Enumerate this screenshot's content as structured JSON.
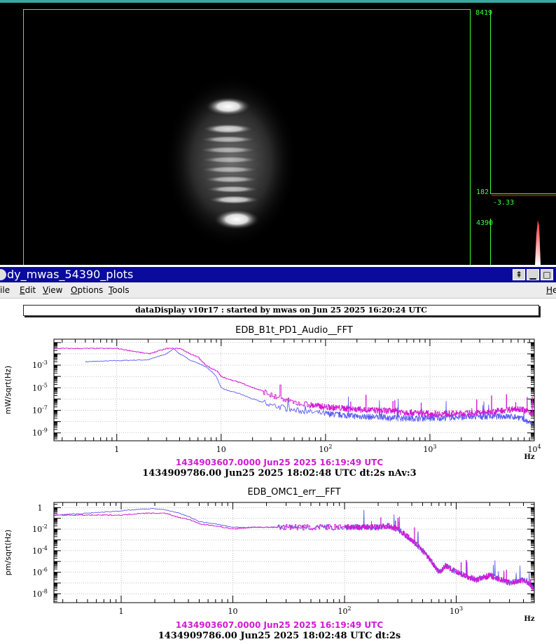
{
  "camera": {
    "readouts": {
      "max_top": "8419",
      "val_mid": "182",
      "val_neg": "-3.33",
      "val_lower": "4390"
    }
  },
  "window": {
    "title": "dy_mwas_54390_plots",
    "menus": [
      "File",
      "Edit",
      "View",
      "Options",
      "Tools"
    ],
    "menu_help": "He",
    "header": "dataDisplay v10r17 : started by mwas on Jun 25 2025 16:20:24 UTC"
  },
  "colors": {
    "reference": "#d21bd2",
    "current": "#5a5af0",
    "grid": "#9a9a9a"
  },
  "plots": [
    {
      "title": "EDB_B1t_PD1_Audio__FFT",
      "ylabel": "mW/sqrt(Hz)",
      "xunit": "Hz",
      "ref_label": "1434903607.0000 Jun25 2025 16:19:49 UTC",
      "cur_label": "1434909786.00 Jun25 2025 18:02:48 UTC dt:2s nAv:3",
      "x_ticks": [
        {
          "v": 1,
          "t": "1"
        },
        {
          "v": 10,
          "t": "10"
        },
        {
          "v": 100,
          "t": "10",
          "s": "2"
        },
        {
          "v": 1000,
          "t": "10",
          "s": "3"
        },
        {
          "v": 10000,
          "t": "10",
          "s": "4"
        }
      ],
      "y_ticks": [
        {
          "e": -3
        },
        {
          "e": -5
        },
        {
          "e": -7
        },
        {
          "e": -9
        }
      ]
    },
    {
      "title": "EDB_OMC1_err__FFT",
      "ylabel": "pm/sqrt(Hz)",
      "xunit": "Hz",
      "ref_label": "1434903607.0000 Jun25 2025 16:19:49 UTC",
      "cur_label": "1434909786.00 Jun25 2025 18:02:48 UTC dt:2s",
      "x_ticks": [
        {
          "v": 1,
          "t": "1"
        },
        {
          "v": 10,
          "t": "10"
        },
        {
          "v": 100,
          "t": "10",
          "s": "2"
        },
        {
          "v": 1000,
          "t": "10",
          "s": "3"
        }
      ],
      "y_ticks": [
        {
          "e": 0,
          "t": "1"
        },
        {
          "e": -2
        },
        {
          "e": -4
        },
        {
          "e": -6
        },
        {
          "e": -8
        }
      ]
    }
  ],
  "chart_data": [
    {
      "type": "line",
      "title": "EDB_B1t_PD1_Audio__FFT",
      "xlabel": "Hz",
      "ylabel": "mW/sqrt(Hz)",
      "xscale": "log",
      "yscale": "log",
      "xlim": [
        0.25,
        10000
      ],
      "ylim": [
        2e-10,
        0.2
      ],
      "grid": true,
      "series": [
        {
          "name": "1434903607.0000 Jun25 2025 16:19:49 UTC",
          "color": "#d21bd2",
          "style": "step",
          "x": [
            0.25,
            0.5,
            1,
            2,
            3,
            4,
            5,
            6,
            7,
            8,
            9,
            10,
            12,
            15,
            20,
            25,
            30,
            40,
            50,
            70,
            100,
            150,
            200,
            300,
            500,
            700,
            1000,
            2000,
            3000,
            5000,
            7000,
            10000
          ],
          "y": [
            0.03,
            0.03,
            0.03,
            0.01,
            0.03,
            0.03,
            0.01,
            0.005,
            0.001,
            0.0005,
            0.0003,
            0.0001,
            5e-05,
            3e-05,
            1e-05,
            5e-06,
            2e-06,
            8e-07,
            5e-07,
            3e-07,
            2e-07,
            1.5e-07,
            1.2e-07,
            1e-07,
            8e-08,
            6e-08,
            5e-08,
            5e-08,
            6e-08,
            1e-07,
            1.5e-07,
            5e-08
          ]
        },
        {
          "name": "1434909786.00 Jun25 2025 18:02:48 UTC dt:2s nAv:3",
          "color": "#5a5af0",
          "style": "line",
          "x": [
            0.5,
            1,
            2,
            3,
            3.5,
            4,
            5,
            6,
            7,
            8,
            9,
            10,
            12,
            15,
            20,
            30,
            50,
            100,
            200,
            500,
            1000,
            2000,
            5000,
            7000,
            10000
          ],
          "y": [
            0.002,
            0.0025,
            0.003,
            0.01,
            0.03,
            0.01,
            0.003,
            0.0015,
            0.0008,
            0.0003,
            0.0001,
            1e-05,
            5e-06,
            3e-06,
            1e-06,
            3e-07,
            1e-07,
            5e-08,
            3e-08,
            2e-08,
            2e-08,
            2.5e-08,
            3e-08,
            2.5e-08,
            5e-09
          ]
        }
      ]
    },
    {
      "type": "line",
      "title": "EDB_OMC1_err__FFT",
      "xlabel": "Hz",
      "ylabel": "pm/sqrt(Hz)",
      "xscale": "log",
      "yscale": "log",
      "xlim": [
        0.25,
        5000
      ],
      "ylim": [
        1.5e-09,
        3
      ],
      "grid": true,
      "series": [
        {
          "name": "1434903607.0000 Jun25 2025 16:19:49 UTC",
          "color": "#d21bd2",
          "style": "step",
          "x": [
            0.25,
            0.5,
            1,
            1.5,
            2,
            2.5,
            3,
            4,
            5,
            7,
            10,
            15,
            20,
            30,
            50,
            100,
            200,
            250,
            300,
            400,
            500,
            600,
            700,
            800,
            1000,
            1500,
            2000,
            3000,
            4000,
            5000
          ],
          "y": [
            0.2,
            0.2,
            0.2,
            0.3,
            0.3,
            0.3,
            0.15,
            0.08,
            0.03,
            0.02,
            0.01,
            0.015,
            0.015,
            0.015,
            0.015,
            0.015,
            0.015,
            0.02,
            0.01,
            0.001,
            0.0001,
            1e-05,
            1e-06,
            4e-06,
            1e-06,
            2e-07,
            5e-07,
            1e-07,
            2e-07,
            3e-08
          ]
        },
        {
          "name": "1434909786.00 Jun25 2025 18:02:48 UTC dt:2s",
          "color": "#5a5af0",
          "style": "line",
          "x": [
            0.25,
            0.5,
            1,
            1.5,
            2,
            2.5,
            3,
            4,
            5,
            7,
            10,
            15,
            20,
            30,
            50,
            100,
            200,
            250,
            300,
            400,
            500,
            600,
            700,
            800,
            1000,
            1500,
            2000,
            3000,
            4000,
            5000
          ],
          "y": [
            0.2,
            0.3,
            0.5,
            0.7,
            0.8,
            0.6,
            0.4,
            0.15,
            0.05,
            0.03,
            0.015,
            0.015,
            0.015,
            0.015,
            0.015,
            0.015,
            0.015,
            0.02,
            0.01,
            0.001,
            0.0001,
            1e-05,
            1e-06,
            4e-06,
            1e-06,
            2e-07,
            5e-07,
            1e-07,
            2e-07,
            3e-08
          ]
        }
      ]
    }
  ]
}
